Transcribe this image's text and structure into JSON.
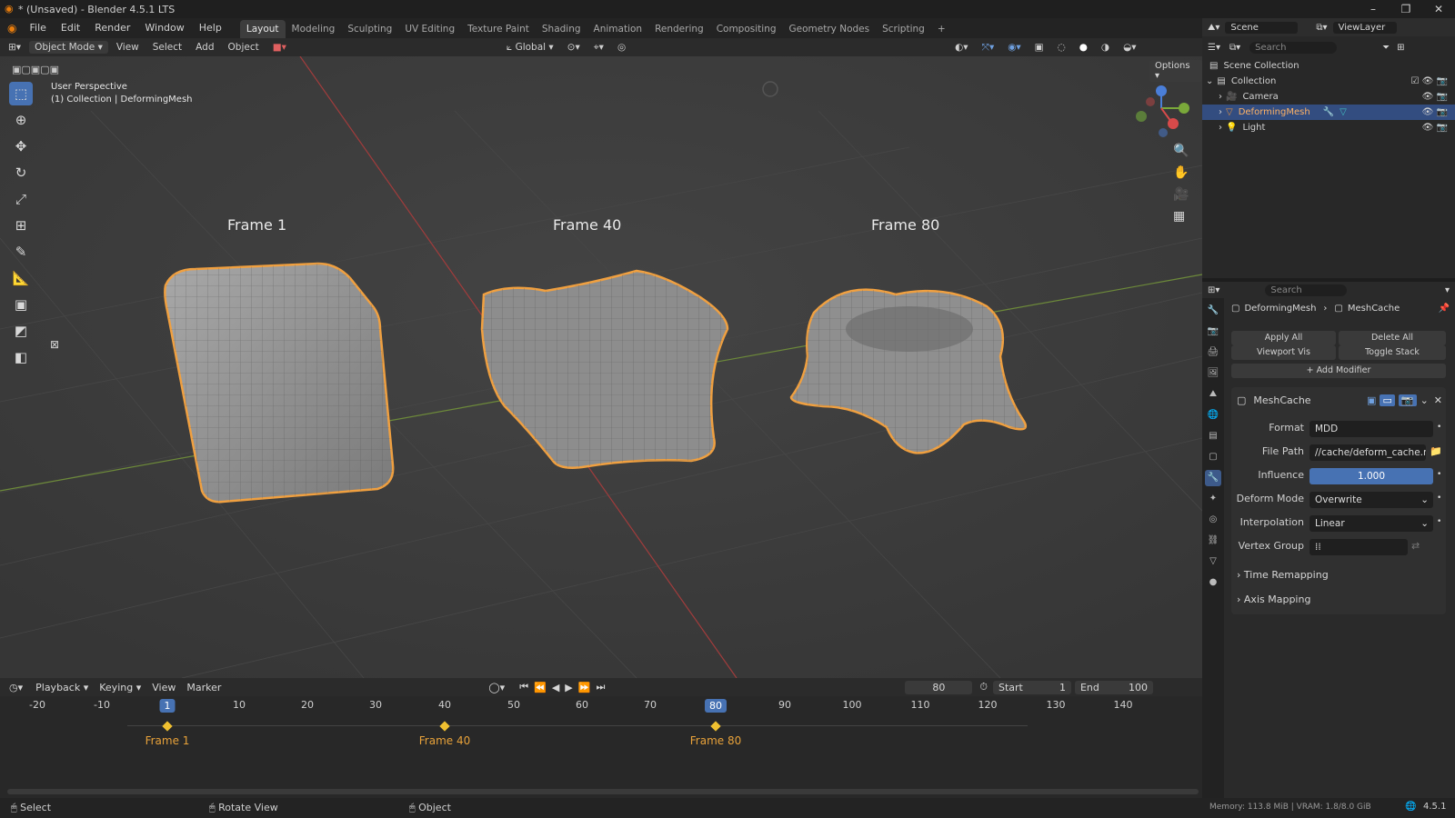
{
  "window": {
    "title": "* (Unsaved) - Blender 4.5.1 LTS"
  },
  "menu": [
    "File",
    "Edit",
    "Render",
    "Window",
    "Help"
  ],
  "workspaces": [
    "Layout",
    "Modeling",
    "Sculpting",
    "UV Editing",
    "Texture Paint",
    "Shading",
    "Animation",
    "Rendering",
    "Compositing",
    "Geometry Nodes",
    "Scripting"
  ],
  "topright": {
    "scene": "Scene",
    "viewlayer": "ViewLayer"
  },
  "viewport_header": {
    "mode": "Object Mode",
    "menus": [
      "View",
      "Select",
      "Add",
      "Object"
    ],
    "transform": "Global",
    "options": "Options"
  },
  "viewport": {
    "perspective": "User Perspective",
    "collection": "(1) Collection | DeformingMesh",
    "frames": [
      "Frame 1",
      "Frame 40",
      "Frame 80"
    ]
  },
  "outliner": {
    "search_placeholder": "Search",
    "root": "Scene Collection",
    "collection": "Collection",
    "items": [
      "Camera",
      "DeformingMesh",
      "Light"
    ]
  },
  "properties": {
    "search_placeholder": "Search",
    "breadcrumb_object": "DeformingMesh",
    "breadcrumb_modifier": "MeshCache",
    "apply_all": "Apply All",
    "delete_all": "Delete All",
    "viewport_vis": "Viewport Vis",
    "toggle_stack": "Toggle Stack",
    "add_modifier": "Add Modifier",
    "modifier_name": "MeshCache",
    "format_label": "Format",
    "format_value": "MDD",
    "filepath_label": "File Path",
    "filepath_value": "//cache/deform_cache.mdd",
    "influence_label": "Influence",
    "influence_value": "1.000",
    "deform_label": "Deform Mode",
    "deform_value": "Overwrite",
    "interp_label": "Interpolation",
    "interp_value": "Linear",
    "vgroup_label": "Vertex Group",
    "time_remapping": "Time Remapping",
    "axis_mapping": "Axis Mapping"
  },
  "timeline": {
    "menus": [
      "Playback",
      "Keying",
      "View",
      "Marker"
    ],
    "current_frame": "80",
    "start_label": "Start",
    "start_value": "1",
    "end_label": "End",
    "end_value": "100",
    "ticks": [
      "-20",
      "-10",
      "1",
      "10",
      "20",
      "30",
      "40",
      "50",
      "60",
      "70",
      "80",
      "90",
      "100",
      "110",
      "120",
      "130",
      "140"
    ],
    "keyframes": [
      "Frame 1",
      "Frame 40",
      "Frame 80"
    ]
  },
  "statusbar": {
    "select": "Select",
    "rotate": "Rotate View",
    "object": "Object",
    "memory": "Memory: 113.8 MiB | VRAM: 1.8/8.0 GiB",
    "version": "4.5.1"
  },
  "colors": {
    "accent": "#4772b3",
    "selection": "#f0a040",
    "keyframe": "#f0c030"
  }
}
